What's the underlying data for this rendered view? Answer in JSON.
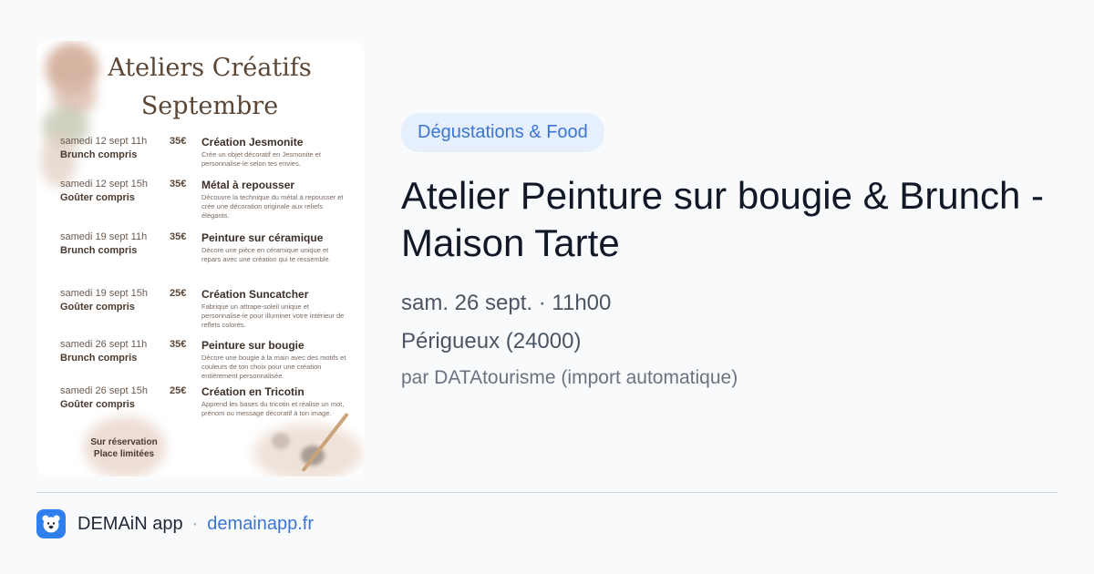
{
  "poster": {
    "title_line1": "Ateliers Créatifs",
    "title_line2": "Septembre",
    "events": [
      {
        "date": "samedi 12 sept 11h",
        "extra": "Brunch compris",
        "price": "35€",
        "name": "Création Jesmonite",
        "description": "Crée un objet décoratif en Jesmonite et personnalise-le selon tes envies."
      },
      {
        "date": "samedi 12 sept 15h",
        "extra": "Goûter compris",
        "price": "35€",
        "name": "Métal à repousser",
        "description": "Découvre la technique du métal à repousser et crée une décoration originale aux reliefs élégants."
      },
      {
        "date": "samedi 19 sept 11h",
        "extra": "Brunch compris",
        "price": "35€",
        "name": "Peinture sur céramique",
        "description": "Décore une pièce en céramique unique et repars avec une création qui te ressemble."
      },
      {
        "date": "samedi 19 sept 15h",
        "extra": "Goûter compris",
        "price": "25€",
        "name": "Création Suncatcher",
        "description": "Fabrique un attrape-soleil unique et personnalise-le pour illuminer votre intérieur de reflets colorés."
      },
      {
        "date": "samedi 26 sept 11h",
        "extra": "Brunch compris",
        "price": "35€",
        "name": "Peinture sur bougie",
        "description": "Décore une bougie à la main avec des motifs et couleurs de ton choix pour une création entièrement personnalisée."
      },
      {
        "date": "samedi 26 sept 15h",
        "extra": "Goûter compris",
        "price": "25€",
        "name": "Création en Tricotin",
        "description": "Apprend les bases du tricotin et réalise un mot, prénom ou message décoratif à ton image."
      }
    ],
    "reservation_line1": "Sur réservation",
    "reservation_line2": "Place limitées"
  },
  "event": {
    "category": "Dégustations & Food",
    "title": "Atelier Peinture sur bougie & Brunch - Maison Tarte",
    "datetime": "sam. 26 sept. · 11h00",
    "location": "Périgueux (24000)",
    "source": "par DATAtourisme (import automatique)"
  },
  "footer": {
    "app_icon": "bear-app-icon",
    "app_name": "DEMAiN app",
    "separator": "·",
    "link": "demainapp.fr"
  },
  "colors": {
    "accent": "#3b76d4",
    "badge_bg": "#e6effc",
    "background": "#f9fafb"
  }
}
